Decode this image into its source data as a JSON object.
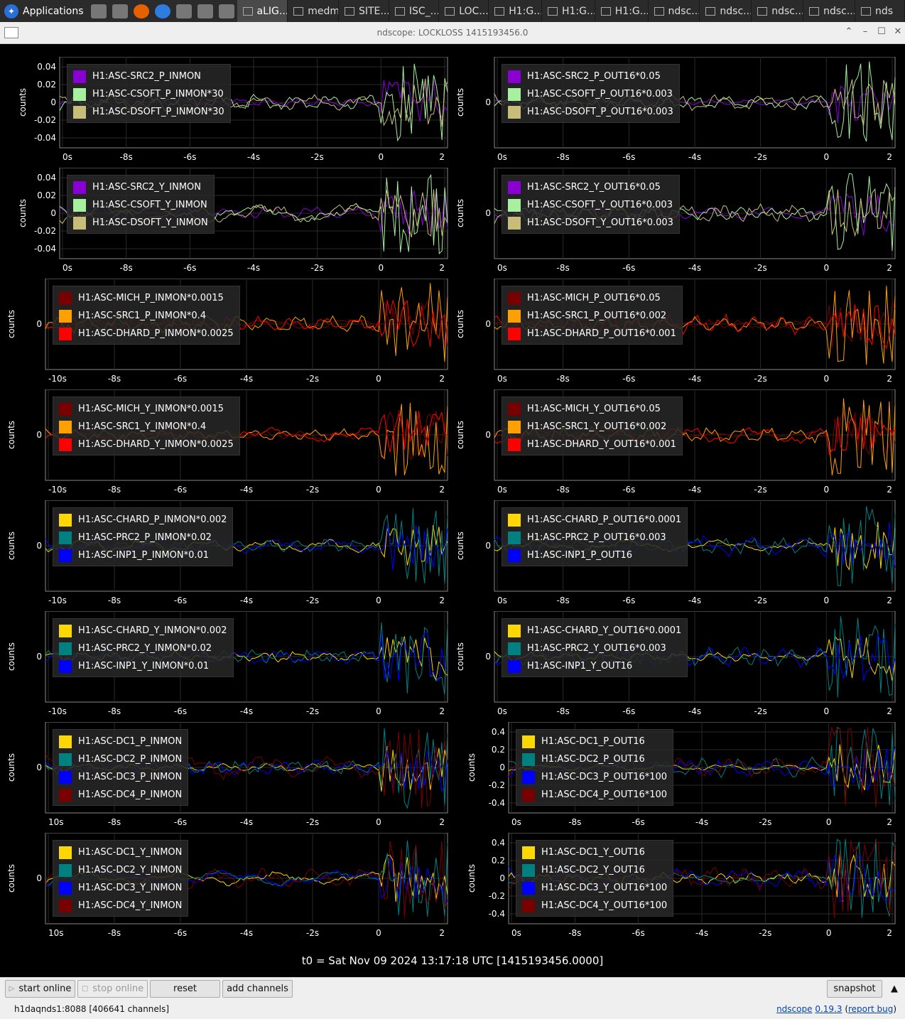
{
  "taskbar": {
    "applications_label": "Applications",
    "tasks": [
      "aLIG...",
      "medm",
      "SITE...",
      "ISC_...",
      "LOC...",
      "H1:G...",
      "H1:G...",
      "H1:G...",
      "ndsc...",
      "ndsc...",
      "ndsc...",
      "ndsc...",
      "nds"
    ]
  },
  "window": {
    "title": "ndscope: LOCKLOSS 1415193456.0"
  },
  "t0_label": "t0 = Sat Nov 09 2024 13:17:18 UTC [1415193456.0000]",
  "ylabel": "counts",
  "plots": [
    {
      "id": "p1",
      "yticks": [
        "0.04",
        "0.02",
        "0",
        "-0.02",
        "-0.04"
      ],
      "xticks": [
        "0s",
        "-8s",
        "-6s",
        "-4s",
        "-2s",
        "0",
        "2"
      ],
      "legend": [
        {
          "name": "H1:ASC-SRC2_P_INMON",
          "color": "#8a00d4"
        },
        {
          "name": "H1:ASC-CSOFT_P_INMON*30",
          "color": "#a6f0a0"
        },
        {
          "name": "H1:ASC-DSOFT_P_INMON*30",
          "color": "#c8bd78"
        }
      ]
    },
    {
      "id": "p2",
      "yticks": [
        "0"
      ],
      "xticks": [
        "0s",
        "-8s",
        "-6s",
        "-4s",
        "-2s",
        "0",
        "2"
      ],
      "legend": [
        {
          "name": "H1:ASC-SRC2_P_OUT16*0.05",
          "color": "#8a00d4"
        },
        {
          "name": "H1:ASC-CSOFT_P_OUT16*0.003",
          "color": "#a6f0a0"
        },
        {
          "name": "H1:ASC-DSOFT_P_OUT16*0.003",
          "color": "#c8bd78"
        }
      ]
    },
    {
      "id": "p3",
      "yticks": [
        "0.04",
        "0.02",
        "0",
        "-0.02",
        "-0.04"
      ],
      "xticks": [
        "0s",
        "-8s",
        "-6s",
        "-4s",
        "-2s",
        "0",
        "2"
      ],
      "legend": [
        {
          "name": "H1:ASC-SRC2_Y_INMON",
          "color": "#8a00d4"
        },
        {
          "name": "H1:ASC-CSOFT_Y_INMON",
          "color": "#a6f0a0"
        },
        {
          "name": "H1:ASC-DSOFT_Y_INMON",
          "color": "#c8bd78"
        }
      ]
    },
    {
      "id": "p4",
      "yticks": [
        "0"
      ],
      "xticks": [
        "0s",
        "-8s",
        "-6s",
        "-4s",
        "-2s",
        "0",
        "2"
      ],
      "legend": [
        {
          "name": "H1:ASC-SRC2_Y_OUT16*0.05",
          "color": "#8a00d4"
        },
        {
          "name": "H1:ASC-CSOFT_Y_OUT16*0.003",
          "color": "#a6f0a0"
        },
        {
          "name": "H1:ASC-DSOFT_Y_OUT16*0.003",
          "color": "#c8bd78"
        }
      ]
    },
    {
      "id": "p5",
      "yticks": [
        "0"
      ],
      "xticks": [
        "-10s",
        "-8s",
        "-6s",
        "-4s",
        "-2s",
        "0",
        "2"
      ],
      "legend": [
        {
          "name": "H1:ASC-MICH_P_INMON*0.0015",
          "color": "#7a0000"
        },
        {
          "name": "H1:ASC-SRC1_P_INMON*0.4",
          "color": "#ffa000"
        },
        {
          "name": "H1:ASC-DHARD_P_INMON*0.0025",
          "color": "#ff0000"
        }
      ]
    },
    {
      "id": "p6",
      "yticks": [
        "0"
      ],
      "xticks": [
        "0s",
        "-8s",
        "-6s",
        "-4s",
        "-2s",
        "0",
        "2"
      ],
      "legend": [
        {
          "name": "H1:ASC-MICH_P_OUT16*0.05",
          "color": "#7a0000"
        },
        {
          "name": "H1:ASC-SRC1_P_OUT16*0.002",
          "color": "#ffa000"
        },
        {
          "name": "H1:ASC-DHARD_P_OUT16*0.001",
          "color": "#ff0000"
        }
      ]
    },
    {
      "id": "p7",
      "yticks": [
        "0"
      ],
      "xticks": [
        "-10s",
        "-8s",
        "-6s",
        "-4s",
        "-2s",
        "0",
        "2"
      ],
      "legend": [
        {
          "name": "H1:ASC-MICH_Y_INMON*0.0015",
          "color": "#7a0000"
        },
        {
          "name": "H1:ASC-SRC1_Y_INMON*0.4",
          "color": "#ffa000"
        },
        {
          "name": "H1:ASC-DHARD_Y_INMON*0.0025",
          "color": "#ff0000"
        }
      ]
    },
    {
      "id": "p8",
      "yticks": [
        "0"
      ],
      "xticks": [
        "0s",
        "-8s",
        "-6s",
        "-4s",
        "-2s",
        "0",
        "2"
      ],
      "legend": [
        {
          "name": "H1:ASC-MICH_Y_OUT16*0.05",
          "color": "#7a0000"
        },
        {
          "name": "H1:ASC-SRC1_Y_OUT16*0.002",
          "color": "#ffa000"
        },
        {
          "name": "H1:ASC-DHARD_Y_OUT16*0.001",
          "color": "#ff0000"
        }
      ]
    },
    {
      "id": "p9",
      "yticks": [
        "0"
      ],
      "xticks": [
        "-10s",
        "-8s",
        "-6s",
        "-4s",
        "-2s",
        "0",
        "2"
      ],
      "legend": [
        {
          "name": "H1:ASC-CHARD_P_INMON*0.002",
          "color": "#ffd700"
        },
        {
          "name": "H1:ASC-PRC2_P_INMON*0.02",
          "color": "#008080"
        },
        {
          "name": "H1:ASC-INP1_P_INMON*0.01",
          "color": "#0000ff"
        }
      ]
    },
    {
      "id": "p10",
      "yticks": [
        "0"
      ],
      "xticks": [
        "0s",
        "-8s",
        "-6s",
        "-4s",
        "-2s",
        "0",
        "2"
      ],
      "legend": [
        {
          "name": "H1:ASC-CHARD_P_OUT16*0.0001",
          "color": "#ffd700"
        },
        {
          "name": "H1:ASC-PRC2_P_OUT16*0.003",
          "color": "#008080"
        },
        {
          "name": "H1:ASC-INP1_P_OUT16",
          "color": "#0000ff"
        }
      ]
    },
    {
      "id": "p11",
      "yticks": [
        "0"
      ],
      "xticks": [
        "-10s",
        "-8s",
        "-6s",
        "-4s",
        "-2s",
        "0",
        "2"
      ],
      "legend": [
        {
          "name": "H1:ASC-CHARD_Y_INMON*0.002",
          "color": "#ffd700"
        },
        {
          "name": "H1:ASC-PRC2_Y_INMON*0.02",
          "color": "#008080"
        },
        {
          "name": "H1:ASC-INP1_Y_INMON*0.01",
          "color": "#0000ff"
        }
      ]
    },
    {
      "id": "p12",
      "yticks": [
        "0"
      ],
      "xticks": [
        "0s",
        "-8s",
        "-6s",
        "-4s",
        "-2s",
        "0",
        "2"
      ],
      "legend": [
        {
          "name": "H1:ASC-CHARD_Y_OUT16*0.0001",
          "color": "#ffd700"
        },
        {
          "name": "H1:ASC-PRC2_Y_OUT16*0.003",
          "color": "#008080"
        },
        {
          "name": "H1:ASC-INP1_Y_OUT16",
          "color": "#0000ff"
        }
      ]
    },
    {
      "id": "p13",
      "yticks": [
        "0"
      ],
      "xticks": [
        "10s",
        "-8s",
        "-6s",
        "-4s",
        "-2s",
        "0",
        "2"
      ],
      "legend": [
        {
          "name": "H1:ASC-DC1_P_INMON",
          "color": "#ffd700"
        },
        {
          "name": "H1:ASC-DC2_P_INMON",
          "color": "#008080"
        },
        {
          "name": "H1:ASC-DC3_P_INMON",
          "color": "#0000ff"
        },
        {
          "name": "H1:ASC-DC4_P_INMON",
          "color": "#7a0000"
        }
      ]
    },
    {
      "id": "p14",
      "yticks": [
        "0.4",
        "0.2",
        "0",
        "-0.2",
        "-0.4"
      ],
      "xticks": [
        "0s",
        "-8s",
        "-6s",
        "-4s",
        "-2s",
        "0",
        "2"
      ],
      "legend": [
        {
          "name": "H1:ASC-DC1_P_OUT16",
          "color": "#ffd700"
        },
        {
          "name": "H1:ASC-DC2_P_OUT16",
          "color": "#008080"
        },
        {
          "name": "H1:ASC-DC3_P_OUT16*100",
          "color": "#0000ff"
        },
        {
          "name": "H1:ASC-DC4_P_OUT16*100",
          "color": "#7a0000"
        }
      ]
    },
    {
      "id": "p15",
      "yticks": [
        "0"
      ],
      "xticks": [
        "10s",
        "-8s",
        "-6s",
        "-4s",
        "-2s",
        "0",
        "2"
      ],
      "legend": [
        {
          "name": "H1:ASC-DC1_Y_INMON",
          "color": "#ffd700"
        },
        {
          "name": "H1:ASC-DC2_Y_INMON",
          "color": "#008080"
        },
        {
          "name": "H1:ASC-DC3_Y_INMON",
          "color": "#0000ff"
        },
        {
          "name": "H1:ASC-DC4_Y_INMON",
          "color": "#7a0000"
        }
      ]
    },
    {
      "id": "p16",
      "yticks": [
        "0.4",
        "0.2",
        "0",
        "-0.2",
        "-0.4"
      ],
      "xticks": [
        "0s",
        "-8s",
        "-6s",
        "-4s",
        "-2s",
        "0",
        "2"
      ],
      "legend": [
        {
          "name": "H1:ASC-DC1_Y_OUT16",
          "color": "#ffd700"
        },
        {
          "name": "H1:ASC-DC2_Y_OUT16",
          "color": "#008080"
        },
        {
          "name": "H1:ASC-DC3_Y_OUT16*100",
          "color": "#0000ff"
        },
        {
          "name": "H1:ASC-DC4_Y_OUT16*100",
          "color": "#7a0000"
        }
      ]
    }
  ],
  "buttons": {
    "start_online": "start online",
    "stop_online": "stop online",
    "reset": "reset",
    "add_channels": "add channels",
    "snapshot": "snapshot"
  },
  "status": {
    "server": "h1daqnds1:8088  [406641 channels]",
    "app_name": "ndscope",
    "version": "0.19.3",
    "report_bug": "report bug"
  }
}
